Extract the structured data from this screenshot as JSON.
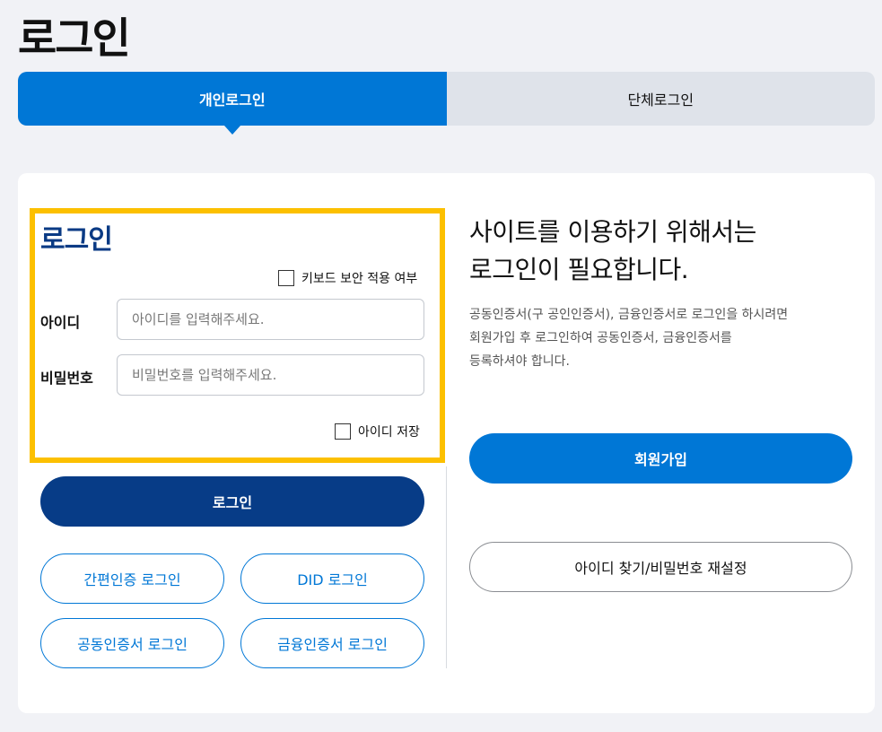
{
  "page": {
    "title": "로그인"
  },
  "tabs": [
    {
      "label": "개인로그인",
      "active": true
    },
    {
      "label": "단체로그인",
      "active": false
    }
  ],
  "form": {
    "title": "로그인",
    "keyboard_security_label": "키보드 보안 적용 여부",
    "id_label": "아이디",
    "id_placeholder": "아이디를 입력해주세요.",
    "id_value": "",
    "password_label": "비밀번호",
    "password_placeholder": "비밀번호를 입력해주세요.",
    "password_value": "",
    "save_id_label": "아이디 저장",
    "login_button": "로그인"
  },
  "alt_login": {
    "simple_auth": "간편인증 로그인",
    "did": "DID 로그인",
    "joint_cert": "공동인증서 로그인",
    "financial_cert": "금융인증서 로그인"
  },
  "info": {
    "heading_line1": "사이트를 이용하기 위해서는",
    "heading_line2": "로그인이 필요합니다.",
    "desc_line1": "공동인증서(구 공인인증서), 금융인증서로 로그인을 하시려면",
    "desc_line2": "회원가입 후 로그인하여 공동인증서, 금융인증서를",
    "desc_line3": "등록하셔야 합니다.",
    "join_button": "회원가입",
    "find_button": "아이디 찾기/비밀번호 재설정"
  },
  "colors": {
    "primary": "#0077d6",
    "navy": "#073c87",
    "highlight": "#fcc000",
    "background": "#f1f2f6"
  }
}
